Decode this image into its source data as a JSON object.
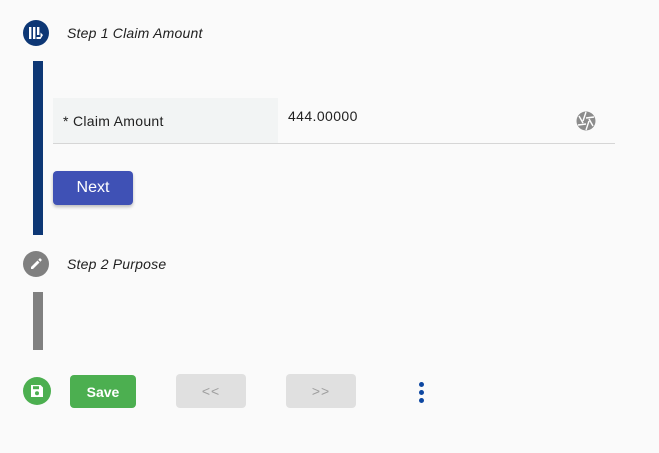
{
  "colors": {
    "active_step": "#0d3775",
    "inactive_step": "#808080",
    "primary_button": "#3f51b5",
    "save_button": "#4caf50",
    "disabled_button": "#e0e0e0",
    "kebab": "#0d47a1"
  },
  "steps": [
    {
      "title": "Step 1 Claim Amount",
      "icon": "claim-amount-icon",
      "state": "active"
    },
    {
      "title": "Step 2 Purpose",
      "icon": "pencil-icon",
      "state": "inactive"
    }
  ],
  "claim_field": {
    "label": "* Claim Amount",
    "value": "444.00000",
    "action_icon": "aperture-icon"
  },
  "step1_actions": {
    "next_label": "Next"
  },
  "footer": {
    "save_icon": "floppy-disk-icon",
    "save_label": "Save",
    "prev_label": "<<",
    "next_label": ">>",
    "more_icon": "more-vertical-icon"
  }
}
